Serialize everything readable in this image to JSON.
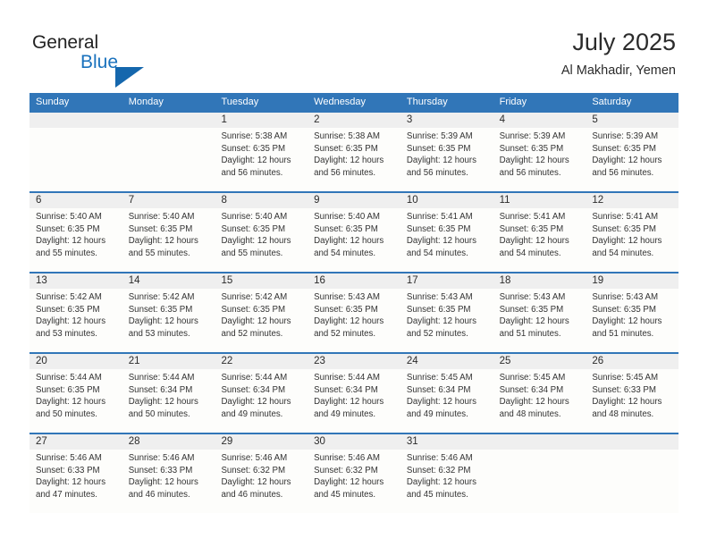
{
  "brand": {
    "name_part1": "General",
    "name_part2": "Blue",
    "logo_icon": "triangle-mark",
    "accent_color": "#1567ad"
  },
  "header": {
    "title": "July 2025",
    "subtitle": "Al Makhadir, Yemen"
  },
  "theme": {
    "header_blue": "#3176b8",
    "daynum_band": "#efefef",
    "cell_bg": "#fdfdfb"
  },
  "calendar": {
    "weekdays": [
      "Sunday",
      "Monday",
      "Tuesday",
      "Wednesday",
      "Thursday",
      "Friday",
      "Saturday"
    ],
    "weeks": [
      [
        {
          "day": "",
          "lines": []
        },
        {
          "day": "",
          "lines": []
        },
        {
          "day": "1",
          "lines": [
            "Sunrise: 5:38 AM",
            "Sunset: 6:35 PM",
            "Daylight: 12 hours",
            "and 56 minutes."
          ]
        },
        {
          "day": "2",
          "lines": [
            "Sunrise: 5:38 AM",
            "Sunset: 6:35 PM",
            "Daylight: 12 hours",
            "and 56 minutes."
          ]
        },
        {
          "day": "3",
          "lines": [
            "Sunrise: 5:39 AM",
            "Sunset: 6:35 PM",
            "Daylight: 12 hours",
            "and 56 minutes."
          ]
        },
        {
          "day": "4",
          "lines": [
            "Sunrise: 5:39 AM",
            "Sunset: 6:35 PM",
            "Daylight: 12 hours",
            "and 56 minutes."
          ]
        },
        {
          "day": "5",
          "lines": [
            "Sunrise: 5:39 AM",
            "Sunset: 6:35 PM",
            "Daylight: 12 hours",
            "and 56 minutes."
          ]
        }
      ],
      [
        {
          "day": "6",
          "lines": [
            "Sunrise: 5:40 AM",
            "Sunset: 6:35 PM",
            "Daylight: 12 hours",
            "and 55 minutes."
          ]
        },
        {
          "day": "7",
          "lines": [
            "Sunrise: 5:40 AM",
            "Sunset: 6:35 PM",
            "Daylight: 12 hours",
            "and 55 minutes."
          ]
        },
        {
          "day": "8",
          "lines": [
            "Sunrise: 5:40 AM",
            "Sunset: 6:35 PM",
            "Daylight: 12 hours",
            "and 55 minutes."
          ]
        },
        {
          "day": "9",
          "lines": [
            "Sunrise: 5:40 AM",
            "Sunset: 6:35 PM",
            "Daylight: 12 hours",
            "and 54 minutes."
          ]
        },
        {
          "day": "10",
          "lines": [
            "Sunrise: 5:41 AM",
            "Sunset: 6:35 PM",
            "Daylight: 12 hours",
            "and 54 minutes."
          ]
        },
        {
          "day": "11",
          "lines": [
            "Sunrise: 5:41 AM",
            "Sunset: 6:35 PM",
            "Daylight: 12 hours",
            "and 54 minutes."
          ]
        },
        {
          "day": "12",
          "lines": [
            "Sunrise: 5:41 AM",
            "Sunset: 6:35 PM",
            "Daylight: 12 hours",
            "and 54 minutes."
          ]
        }
      ],
      [
        {
          "day": "13",
          "lines": [
            "Sunrise: 5:42 AM",
            "Sunset: 6:35 PM",
            "Daylight: 12 hours",
            "and 53 minutes."
          ]
        },
        {
          "day": "14",
          "lines": [
            "Sunrise: 5:42 AM",
            "Sunset: 6:35 PM",
            "Daylight: 12 hours",
            "and 53 minutes."
          ]
        },
        {
          "day": "15",
          "lines": [
            "Sunrise: 5:42 AM",
            "Sunset: 6:35 PM",
            "Daylight: 12 hours",
            "and 52 minutes."
          ]
        },
        {
          "day": "16",
          "lines": [
            "Sunrise: 5:43 AM",
            "Sunset: 6:35 PM",
            "Daylight: 12 hours",
            "and 52 minutes."
          ]
        },
        {
          "day": "17",
          "lines": [
            "Sunrise: 5:43 AM",
            "Sunset: 6:35 PM",
            "Daylight: 12 hours",
            "and 52 minutes."
          ]
        },
        {
          "day": "18",
          "lines": [
            "Sunrise: 5:43 AM",
            "Sunset: 6:35 PM",
            "Daylight: 12 hours",
            "and 51 minutes."
          ]
        },
        {
          "day": "19",
          "lines": [
            "Sunrise: 5:43 AM",
            "Sunset: 6:35 PM",
            "Daylight: 12 hours",
            "and 51 minutes."
          ]
        }
      ],
      [
        {
          "day": "20",
          "lines": [
            "Sunrise: 5:44 AM",
            "Sunset: 6:35 PM",
            "Daylight: 12 hours",
            "and 50 minutes."
          ]
        },
        {
          "day": "21",
          "lines": [
            "Sunrise: 5:44 AM",
            "Sunset: 6:34 PM",
            "Daylight: 12 hours",
            "and 50 minutes."
          ]
        },
        {
          "day": "22",
          "lines": [
            "Sunrise: 5:44 AM",
            "Sunset: 6:34 PM",
            "Daylight: 12 hours",
            "and 49 minutes."
          ]
        },
        {
          "day": "23",
          "lines": [
            "Sunrise: 5:44 AM",
            "Sunset: 6:34 PM",
            "Daylight: 12 hours",
            "and 49 minutes."
          ]
        },
        {
          "day": "24",
          "lines": [
            "Sunrise: 5:45 AM",
            "Sunset: 6:34 PM",
            "Daylight: 12 hours",
            "and 49 minutes."
          ]
        },
        {
          "day": "25",
          "lines": [
            "Sunrise: 5:45 AM",
            "Sunset: 6:34 PM",
            "Daylight: 12 hours",
            "and 48 minutes."
          ]
        },
        {
          "day": "26",
          "lines": [
            "Sunrise: 5:45 AM",
            "Sunset: 6:33 PM",
            "Daylight: 12 hours",
            "and 48 minutes."
          ]
        }
      ],
      [
        {
          "day": "27",
          "lines": [
            "Sunrise: 5:46 AM",
            "Sunset: 6:33 PM",
            "Daylight: 12 hours",
            "and 47 minutes."
          ]
        },
        {
          "day": "28",
          "lines": [
            "Sunrise: 5:46 AM",
            "Sunset: 6:33 PM",
            "Daylight: 12 hours",
            "and 46 minutes."
          ]
        },
        {
          "day": "29",
          "lines": [
            "Sunrise: 5:46 AM",
            "Sunset: 6:32 PM",
            "Daylight: 12 hours",
            "and 46 minutes."
          ]
        },
        {
          "day": "30",
          "lines": [
            "Sunrise: 5:46 AM",
            "Sunset: 6:32 PM",
            "Daylight: 12 hours",
            "and 45 minutes."
          ]
        },
        {
          "day": "31",
          "lines": [
            "Sunrise: 5:46 AM",
            "Sunset: 6:32 PM",
            "Daylight: 12 hours",
            "and 45 minutes."
          ]
        },
        {
          "day": "",
          "lines": []
        },
        {
          "day": "",
          "lines": []
        }
      ]
    ]
  }
}
